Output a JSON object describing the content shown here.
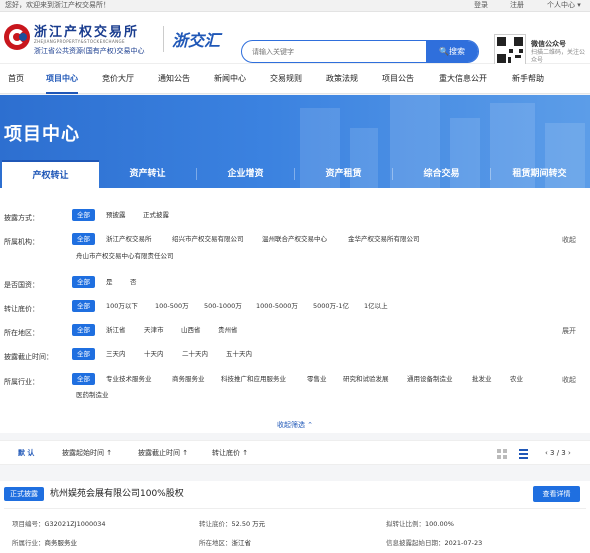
{
  "topbar": {
    "welcome": "您好，欢迎来到浙江产权交易所！",
    "login": "登录",
    "register": "注册",
    "personal_center": "个人中心 ▾"
  },
  "header": {
    "logo_name": "浙江产权交易所",
    "logo_en": "ZHEJIANGPROPERTY&STOCKEXCHANGE",
    "logo_sub": "浙江省公共资源(国有产权)交易中心",
    "brand2": "浙交汇",
    "search_placeholder": "请输入关键字",
    "search_button": "🔍搜索",
    "wechat_title": "微信公众号",
    "wechat_desc": "扫描二维码，关注公众号"
  },
  "nav": [
    "首页",
    "项目中心",
    "竞价大厅",
    "通知公告",
    "新闻中心",
    "交易规则",
    "政策法规",
    "项目公告",
    "重大信息公开",
    "新手帮助"
  ],
  "banner_title": "项目中心",
  "tabs": [
    "产权转让",
    "资产转让",
    "企业增资",
    "资产租赁",
    "综合交易",
    "租赁期间转交"
  ],
  "filters": [
    {
      "label": "披露方式：",
      "options": [
        "全部",
        "预披露",
        "正式披露"
      ]
    },
    {
      "label": "所属机构：",
      "options": [
        "全部",
        "浙江产权交易所",
        "绍兴市产权交易有限公司",
        "温州联合产权交易中心",
        "金华产权交易所有限公司",
        "舟山市产权交易中心有限责任公司"
      ],
      "toggle": "收起"
    },
    {
      "label": "是否国资：",
      "options": [
        "全部",
        "是",
        "否"
      ]
    },
    {
      "label": "转让底价：",
      "options": [
        "全部",
        "100万以下",
        "100-500万",
        "500-1000万",
        "1000-5000万",
        "5000万-1亿",
        "1亿以上"
      ]
    },
    {
      "label": "所在地区：",
      "options": [
        "全部",
        "浙江省",
        "天津市",
        "山西省",
        "贵州省"
      ],
      "toggle": "展开"
    },
    {
      "label": "披露截止时间：",
      "options": [
        "全部",
        "三天内",
        "十天内",
        "二十天内",
        "五十天内"
      ]
    },
    {
      "label": "所属行业：",
      "options": [
        "全部",
        "专业技术服务业",
        "商务服务业",
        "科技推广和应用服务业",
        "零售业",
        "研究和试验发展",
        "通用设备制造业",
        "批发业",
        "农业",
        "医药制造业"
      ],
      "toggle": "收起"
    }
  ],
  "collapse_link": "收起筛选 ⌃",
  "sortbar": {
    "items": [
      "默 认",
      "披露起始时间 ↑",
      "披露截止时间 ↑",
      "转让底价 ↑"
    ],
    "pager": "‹  3 / 3  ›"
  },
  "card": {
    "badge": "正式披露",
    "title": "杭州娱苑会展有限公司100%股权",
    "detail_button": "查看详情",
    "fields": [
      {
        "k": "项目编号：",
        "v": "G32021ZJ1000034"
      },
      {
        "k": "转让底价：",
        "v": "52.50 万元"
      },
      {
        "k": "拟转让比例：",
        "v": "100.00%"
      },
      {
        "k": "所属行业：",
        "v": "商务服务业"
      },
      {
        "k": "所在地区：",
        "v": "浙江省"
      },
      {
        "k": "信息披露起始日期：",
        "v": "2021-07-23"
      }
    ]
  },
  "colors": {
    "primary": "#1f6fe0",
    "brand_red": "#c8161d",
    "brand_blue": "#1a3d8f"
  },
  "icons": [
    "logo-icon",
    "search-icon",
    "qr-code-icon",
    "grid-view-icon",
    "list-view-icon",
    "chevron-up-icon"
  ]
}
